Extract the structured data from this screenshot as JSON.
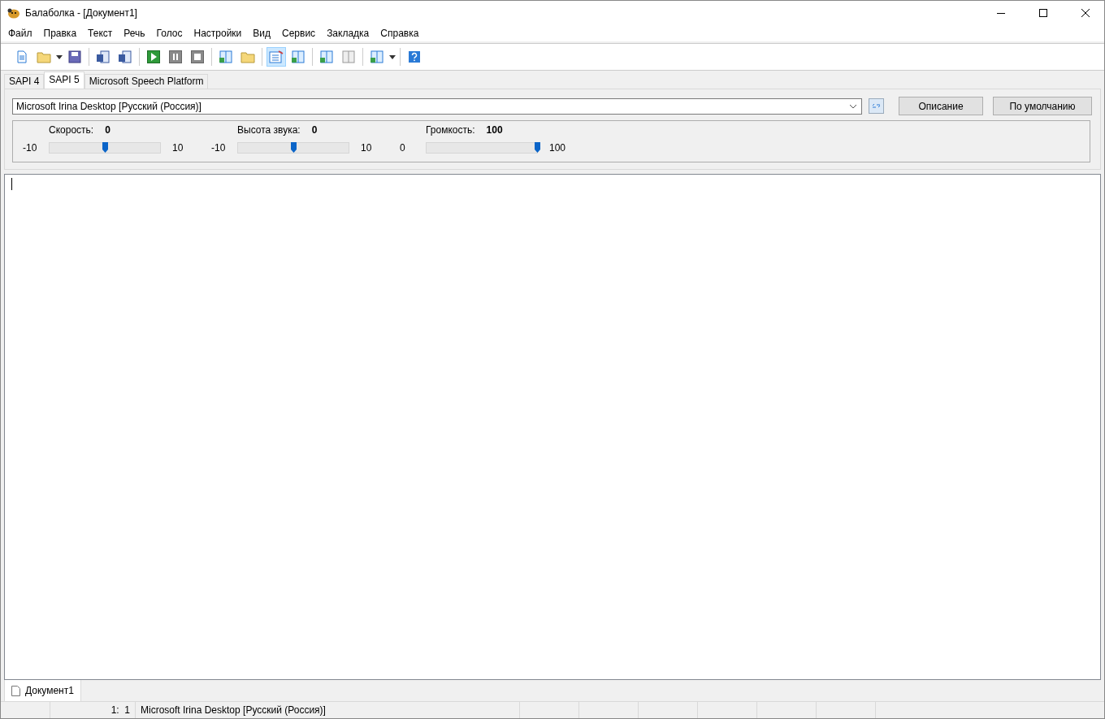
{
  "window": {
    "title": "Балаболка - [Документ1]"
  },
  "menu": [
    "Файл",
    "Правка",
    "Текст",
    "Речь",
    "Голос",
    "Настройки",
    "Вид",
    "Сервис",
    "Закладка",
    "Справка"
  ],
  "toolbar": [
    {
      "kind": "new",
      "pressed": false
    },
    {
      "kind": "open",
      "pressed": false
    },
    {
      "kind": "caret",
      "pressed": false
    },
    {
      "kind": "save",
      "pressed": false
    },
    {
      "kind": "sep"
    },
    {
      "kind": "export",
      "pressed": false
    },
    {
      "kind": "export",
      "pressed": false
    },
    {
      "kind": "sep"
    },
    {
      "kind": "play",
      "pressed": false
    },
    {
      "kind": "pause",
      "pressed": false
    },
    {
      "kind": "stop",
      "pressed": false
    },
    {
      "kind": "sep"
    },
    {
      "kind": "book",
      "pressed": false
    },
    {
      "kind": "folder",
      "pressed": false
    },
    {
      "kind": "sep"
    },
    {
      "kind": "note",
      "pressed": true
    },
    {
      "kind": "book",
      "pressed": false
    },
    {
      "kind": "sep"
    },
    {
      "kind": "book",
      "pressed": false
    },
    {
      "kind": "bookgrey",
      "pressed": false
    },
    {
      "kind": "sep"
    },
    {
      "kind": "book",
      "pressed": false
    },
    {
      "kind": "caret",
      "pressed": false
    },
    {
      "kind": "sep"
    },
    {
      "kind": "help",
      "pressed": false
    }
  ],
  "engine_tabs": [
    {
      "label": "SAPI 4",
      "selected": false
    },
    {
      "label": "SAPI 5",
      "selected": true
    },
    {
      "label": "Microsoft Speech Platform",
      "selected": false
    }
  ],
  "voice": {
    "value": "Microsoft Irina Desktop [Русский (Россия)]"
  },
  "buttons": [
    "Описание",
    "По умолчанию"
  ],
  "sliders": [
    {
      "label": "Скорость:",
      "reading": "0",
      "min": "-10",
      "max": "10",
      "level": 0.5
    },
    {
      "label": "Высота звука:",
      "reading": "0",
      "min": "-10",
      "max": "10",
      "level": 0.5
    },
    {
      "label": "Громкость:",
      "reading": "100",
      "min": "0",
      "max": "100",
      "level": 1
    }
  ],
  "document_tabs": [
    {
      "label": "Документ1",
      "selected": true
    }
  ],
  "status_bar": {
    "position": "1:  1",
    "voice": "Microsoft Irina Desktop [Русский (Россия)]"
  }
}
